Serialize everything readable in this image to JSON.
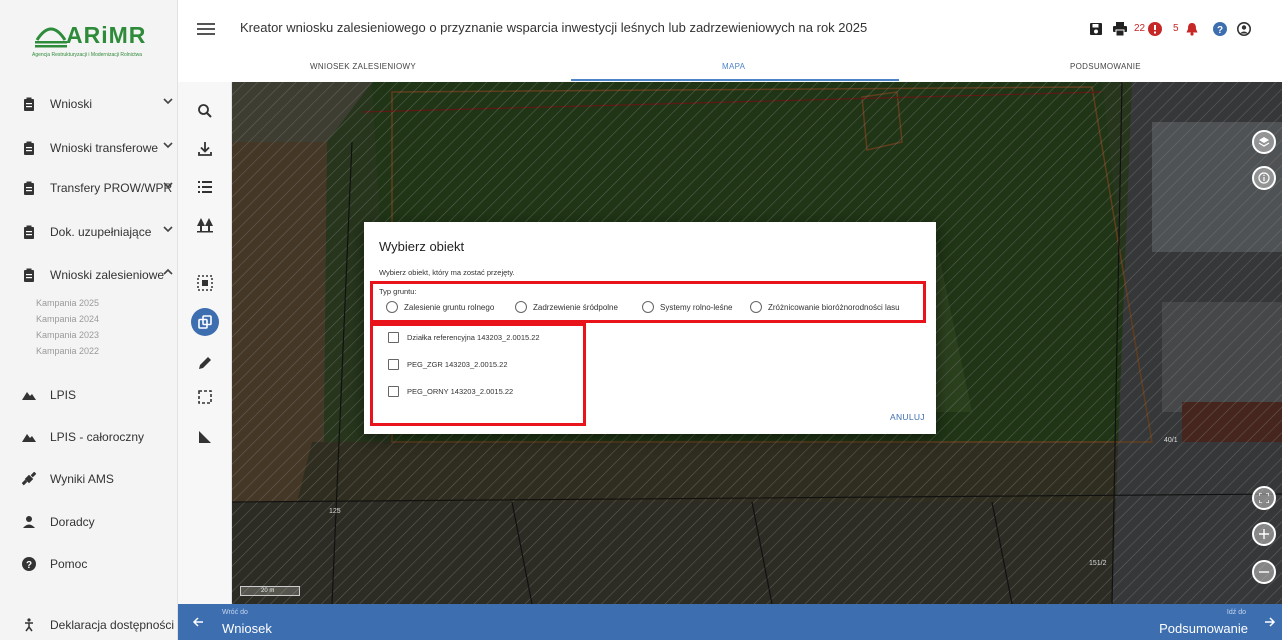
{
  "logo": {
    "brand": "ARiMR",
    "subtitle": "Agencja Restrukturyzacji i Modernizacji Rolnictwa"
  },
  "sidebar": {
    "items": [
      {
        "label": "Wnioski",
        "icon": "clipboard-icon"
      },
      {
        "label": "Wnioski transferowe",
        "icon": "clipboard-icon"
      },
      {
        "label": "Transfery PROW/WPR",
        "icon": "clipboard-icon"
      },
      {
        "label": "Dok. uzupełniające",
        "icon": "clipboard-icon"
      },
      {
        "label": "Wnioski zalesieniowe",
        "icon": "clipboard-icon"
      },
      {
        "label": "LPIS",
        "icon": "mountain-icon"
      },
      {
        "label": "LPIS - całoroczny",
        "icon": "mountain-icon"
      },
      {
        "label": "Wyniki AMS",
        "icon": "satellite-icon"
      },
      {
        "label": "Doradcy",
        "icon": "person-icon"
      },
      {
        "label": "Pomoc",
        "icon": "help-icon"
      },
      {
        "label": "Deklaracja dostępności",
        "icon": "accessibility-icon"
      }
    ],
    "campaigns": [
      "Kampania 2025",
      "Kampania 2024",
      "Kampania 2023",
      "Kampania 2022"
    ]
  },
  "header": {
    "title": "Kreator wniosku zalesieniowego o przyznanie wsparcia inwestycji leśnych lub zadrzewieniowych na rok 2025",
    "errors_count": "22",
    "alerts_count": "5"
  },
  "tabs": [
    "WNIOSEK ZALESIENIOWY",
    "MAPA",
    "PODSUMOWANIE"
  ],
  "active_tab": "MAPA",
  "map": {
    "scale": "20 m",
    "labels": [
      "125",
      "151/2",
      "40/1"
    ]
  },
  "footer": {
    "back_small": "Wróć do",
    "back_label": "Wniosek",
    "next_small": "Idź do",
    "next_label": "Podsumowanie"
  },
  "dialog": {
    "title": "Wybierz obiekt",
    "description": "Wybierz obiekt, który ma zostać przejęty.",
    "group_label": "Typ gruntu:",
    "radio_options": [
      "Zalesienie gruntu rolnego",
      "Zadrzewienie śródpolne",
      "Systemy rolno-leśne",
      "Zróżnicowanie bioróżnorodności lasu"
    ],
    "checkbox_options": [
      "Działka referencyjna 143203_2.0015.22",
      "PEG_ZGR 143203_2.0015.22",
      "PEG_ORNY 143203_2.0015.22"
    ],
    "cancel_label": "ANULUJ"
  },
  "colors": {
    "brand_green": "#2e8b3a",
    "accent_blue": "#3d6eb0",
    "highlight_red": "#e8131b"
  }
}
